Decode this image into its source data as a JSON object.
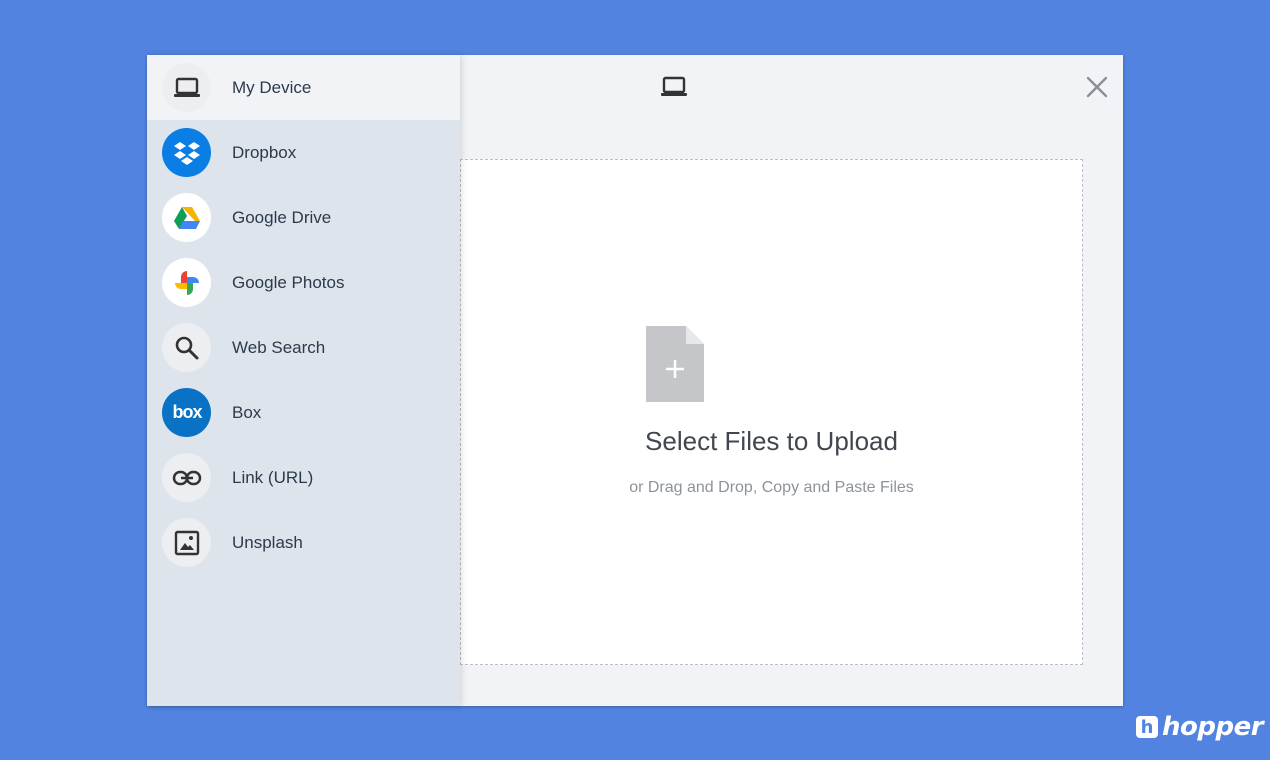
{
  "sidebar": {
    "items": [
      {
        "label": "My Device",
        "icon": "laptop-icon"
      },
      {
        "label": "Dropbox",
        "icon": "dropbox-icon"
      },
      {
        "label": "Google Drive",
        "icon": "google-drive-icon"
      },
      {
        "label": "Google Photos",
        "icon": "google-photos-icon"
      },
      {
        "label": "Web Search",
        "icon": "search-icon"
      },
      {
        "label": "Box",
        "icon": "box-icon"
      },
      {
        "label": "Link (URL)",
        "icon": "link-icon"
      },
      {
        "label": "Unsplash",
        "icon": "image-icon"
      }
    ],
    "active": "My Device"
  },
  "header": {
    "icon": "laptop-icon"
  },
  "dropzone": {
    "title": "Select Files to Upload",
    "subtitle": "or Drag and Drop, Copy and Paste Files"
  },
  "brand": {
    "name": "hopper",
    "mark": "h"
  },
  "colors": {
    "background": "#5283e0",
    "sidebar": "#dde4ec",
    "panel": "#f1f3f7",
    "dropbox": "#0a7ee5",
    "box": "#0a72c4"
  }
}
